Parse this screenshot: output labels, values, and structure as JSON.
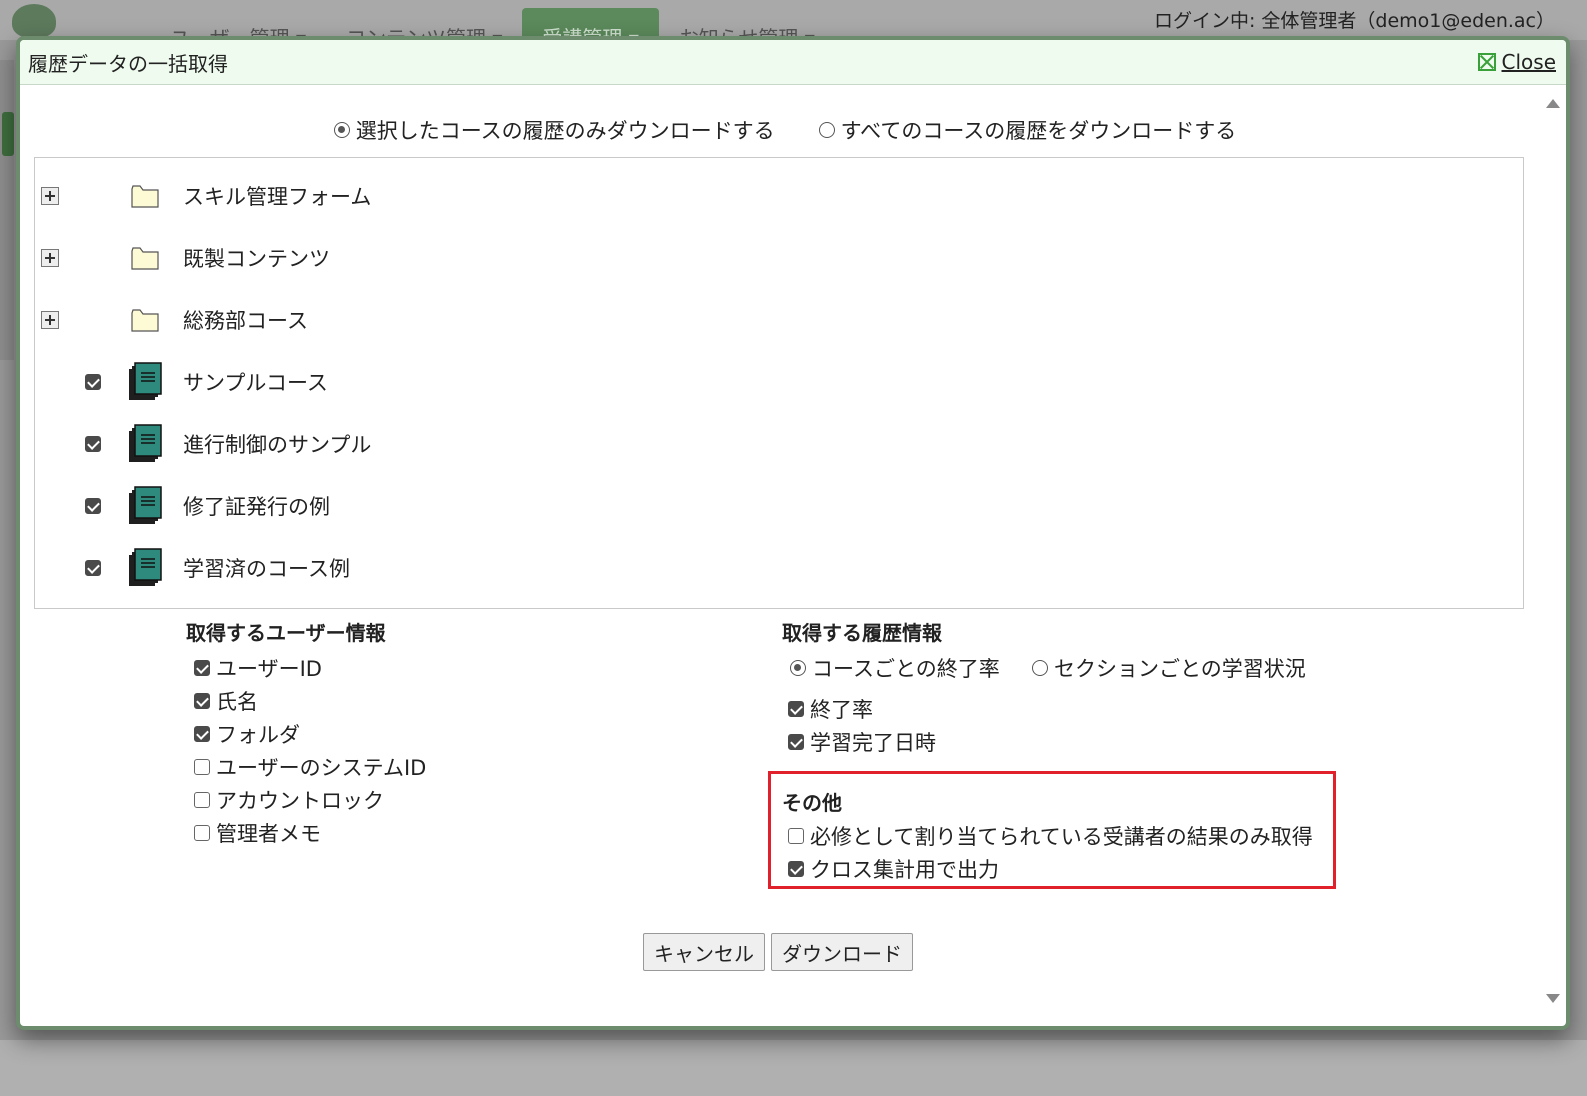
{
  "background": {
    "menu": [
      {
        "label": "ユーザー管理 ▾",
        "active": false
      },
      {
        "label": "コンテンツ管理 ▾",
        "active": false
      },
      {
        "label": "受講管理 ▾",
        "active": true
      },
      {
        "label": "お知らせ管理 ▾",
        "active": false
      }
    ],
    "login_status": "ログイン中: 全体管理者（demo1@eden.ac）"
  },
  "dialog": {
    "title": "履歴データの一括取得",
    "close_label": "Close"
  },
  "scope": {
    "selected_only": "選択したコースの履歴のみダウンロードする",
    "all_courses": "すべてのコースの履歴をダウンロードする",
    "selected": "selected_only"
  },
  "tree": {
    "folders": [
      {
        "label": "スキル管理フォーム"
      },
      {
        "label": "既製コンテンツ"
      },
      {
        "label": "総務部コース"
      }
    ],
    "courses": [
      {
        "label": "サンプルコース",
        "checked": true
      },
      {
        "label": "進行制御のサンプル",
        "checked": true
      },
      {
        "label": "修了証発行の例",
        "checked": true
      },
      {
        "label": "学習済のコース例",
        "checked": true
      }
    ]
  },
  "user_info": {
    "title": "取得するユーザー情報",
    "items": [
      {
        "label": "ユーザーID",
        "checked": true
      },
      {
        "label": "氏名",
        "checked": true
      },
      {
        "label": "フォルダ",
        "checked": true
      },
      {
        "label": "ユーザーのシステムID",
        "checked": false
      },
      {
        "label": "アカウントロック",
        "checked": false
      },
      {
        "label": "管理者メモ",
        "checked": false
      }
    ]
  },
  "history_info": {
    "title": "取得する履歴情報",
    "mode_course": "コースごとの終了率",
    "mode_section": "セクションごとの学習状況",
    "selected_mode": "course",
    "items": [
      {
        "label": "終了率",
        "checked": true
      },
      {
        "label": "学習完了日時",
        "checked": true
      }
    ]
  },
  "other": {
    "title": "その他",
    "items": [
      {
        "label": "必修として割り当てられている受講者の結果のみ取得",
        "checked": false
      },
      {
        "label": "クロス集計用で出力",
        "checked": true
      }
    ]
  },
  "buttons": {
    "cancel": "キャンセル",
    "download": "ダウンロード"
  },
  "colors": {
    "accent_green": "#6d8c6d",
    "header_bg": "#eefbee",
    "highlight_red": "#e0202a",
    "course_icon": "#2f8a7e"
  }
}
